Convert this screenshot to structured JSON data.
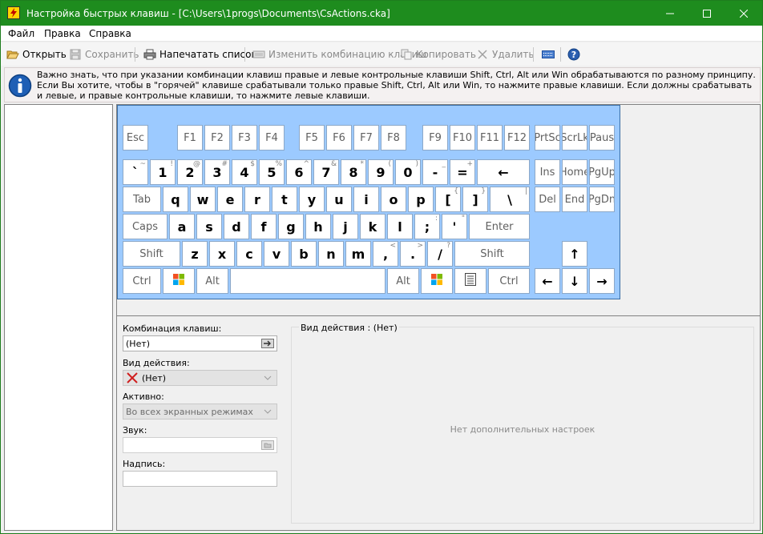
{
  "window": {
    "title": "Настройка быстрых клавиш - [C:\\Users\\1progs\\Documents\\CsActions.cka]"
  },
  "menu": [
    "Файл",
    "Правка",
    "Справка"
  ],
  "toolbar": {
    "open": "Открыть",
    "save": "Сохранить",
    "print": "Напечатать список",
    "change_combo": "Изменить комбинацию клавиш",
    "copy": "Копировать",
    "delete": "Удалить"
  },
  "info": {
    "text": "Важно знать, что при указании комбинации клавиш правые и левые контрольные клавиши Shift, Ctrl, Alt или Win обрабатываются по разному принципу. Если Вы хотите, чтобы в \"горячей\" клавише срабатывали только правые Shift, Ctrl, Alt или Win, то нажмите правые клавиши. Если должны срабатывать и левые, и правые контрольные клавиши, то нажмите левые клавиши."
  },
  "keyboard": {
    "rows": [
      [
        {
          "label": "Esc"
        },
        {
          "label": "F1"
        },
        {
          "label": "F2"
        },
        {
          "label": "F3"
        },
        {
          "label": "F4"
        },
        {
          "label": "F5"
        },
        {
          "label": "F6"
        },
        {
          "label": "F7"
        },
        {
          "label": "F8"
        },
        {
          "label": "F9"
        },
        {
          "label": "F10"
        },
        {
          "label": "F11"
        },
        {
          "label": "F12"
        },
        {
          "label": "PrtSc"
        },
        {
          "label": "ScrLk"
        },
        {
          "label": "Paus"
        }
      ],
      [
        {
          "label": "`",
          "sup": "~",
          "big": true
        },
        {
          "label": "1",
          "sup": "!",
          "big": true
        },
        {
          "label": "2",
          "sup": "@",
          "big": true
        },
        {
          "label": "3",
          "sup": "#",
          "big": true
        },
        {
          "label": "4",
          "sup": "$",
          "big": true
        },
        {
          "label": "5",
          "sup": "%",
          "big": true
        },
        {
          "label": "6",
          "sup": "^",
          "big": true
        },
        {
          "label": "7",
          "sup": "&",
          "big": true
        },
        {
          "label": "8",
          "sup": "*",
          "big": true
        },
        {
          "label": "9",
          "sup": "(",
          "big": true
        },
        {
          "label": "0",
          "sup": ")",
          "big": true
        },
        {
          "label": "-",
          "sup": "_",
          "big": true
        },
        {
          "label": "=",
          "sup": "+",
          "big": true
        },
        {
          "label": "←",
          "big": true
        },
        {
          "label": "Ins"
        },
        {
          "label": "Home"
        },
        {
          "label": "PgUp"
        }
      ],
      [
        {
          "label": "Tab"
        },
        {
          "label": "q",
          "big": true
        },
        {
          "label": "w",
          "big": true
        },
        {
          "label": "e",
          "big": true
        },
        {
          "label": "r",
          "big": true
        },
        {
          "label": "t",
          "big": true
        },
        {
          "label": "y",
          "big": true
        },
        {
          "label": "u",
          "big": true
        },
        {
          "label": "i",
          "big": true
        },
        {
          "label": "o",
          "big": true
        },
        {
          "label": "p",
          "big": true
        },
        {
          "label": "[",
          "sup": "{",
          "big": true
        },
        {
          "label": "]",
          "sup": "}",
          "big": true
        },
        {
          "label": "\\",
          "sup": "|",
          "big": true
        },
        {
          "label": "Del"
        },
        {
          "label": "End"
        },
        {
          "label": "PgDn"
        }
      ],
      [
        {
          "label": "Caps"
        },
        {
          "label": "a",
          "big": true
        },
        {
          "label": "s",
          "big": true
        },
        {
          "label": "d",
          "big": true
        },
        {
          "label": "f",
          "big": true
        },
        {
          "label": "g",
          "big": true
        },
        {
          "label": "h",
          "big": true
        },
        {
          "label": "j",
          "big": true
        },
        {
          "label": "k",
          "big": true
        },
        {
          "label": "l",
          "big": true
        },
        {
          "label": ";",
          "sup": ":",
          "big": true
        },
        {
          "label": "'",
          "sup": "\"",
          "big": true
        },
        {
          "label": "Enter"
        }
      ],
      [
        {
          "label": "Shift"
        },
        {
          "label": "z",
          "big": true
        },
        {
          "label": "x",
          "big": true
        },
        {
          "label": "c",
          "big": true
        },
        {
          "label": "v",
          "big": true
        },
        {
          "label": "b",
          "big": true
        },
        {
          "label": "n",
          "big": true
        },
        {
          "label": "m",
          "big": true
        },
        {
          "label": ",",
          "sup": "<",
          "big": true
        },
        {
          "label": ".",
          "sup": ">",
          "big": true
        },
        {
          "label": "/",
          "sup": "?",
          "big": true
        },
        {
          "label": "Shift"
        },
        {
          "label": "↑",
          "big": true
        }
      ],
      [
        {
          "label": "Ctrl"
        },
        {
          "label": "",
          "icon": "windows-icon"
        },
        {
          "label": "Alt"
        },
        {
          "label": ""
        },
        {
          "label": "Alt"
        },
        {
          "label": "",
          "icon": "windows-icon"
        },
        {
          "label": "",
          "icon": "menu-icon"
        },
        {
          "label": "Ctrl"
        },
        {
          "label": "←",
          "big": true
        },
        {
          "label": "↓",
          "big": true
        },
        {
          "label": "→",
          "big": true
        }
      ]
    ]
  },
  "form": {
    "combo_label": "Комбинация клавиш:",
    "combo_value": "(Нет)",
    "action_type_label": "Вид действия:",
    "action_type_value": "(Нет)",
    "active_label": "Активно:",
    "active_value": "Во всех экранных режимах",
    "sound_label": "Звук:",
    "sound_value": "",
    "caption_label": "Надпись:",
    "caption_value": ""
  },
  "action_group": {
    "title": "Вид действия : (Нет)",
    "empty_text": "Нет дополнительных настроек"
  },
  "colors": {
    "titlebar": "#1e8c1e",
    "keyboard_bg": "#9ccaff"
  }
}
